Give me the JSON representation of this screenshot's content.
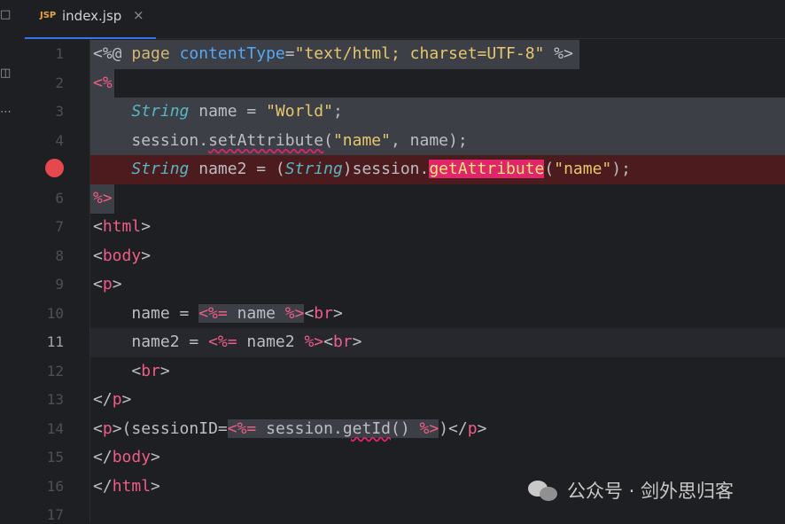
{
  "tab": {
    "badge": "JSP",
    "title": "index.jsp",
    "close": "×"
  },
  "line_numbers": [
    "1",
    "2",
    "3",
    "4",
    "5",
    "6",
    "7",
    "8",
    "9",
    "10",
    "11",
    "12",
    "13",
    "14",
    "15",
    "16",
    "17"
  ],
  "current_line": 11,
  "breakpoint_line": 5,
  "code": {
    "l1": {
      "open": "<%@",
      "page": "page",
      "attr": "contentType",
      "eq": "=",
      "value": "\"text/html; charset=UTF-8\"",
      "close": "%>"
    },
    "l2": {
      "open": "<%"
    },
    "l3": {
      "type": "String",
      "rest": " name = ",
      "value": "\"World\"",
      "semi": ";"
    },
    "l4": {
      "obj": "session",
      "dot": ".",
      "method": "setAttribute",
      "args_open": "(",
      "arg1": "\"name\"",
      "args_rest": ", name",
      "args_close": ");"
    },
    "l5": {
      "type": "String",
      "rest": " name2 = (",
      "cast": "String",
      "obj": ")session",
      "dot": ".",
      "method": "getAttribute",
      "paren": "(",
      "arg": "\"name\"",
      "close": ");"
    },
    "l6": {
      "close": "%>"
    },
    "l7": {
      "lt": "<",
      "tag": "html",
      "gt": ">"
    },
    "l8": {
      "lt": "<",
      "tag": "body",
      "gt": ">"
    },
    "l9": {
      "lt": "<",
      "tag": "p",
      "gt": ">"
    },
    "l10": {
      "text": "name = ",
      "expr_open": "<%=",
      "expr": " name ",
      "expr_close": "%>",
      "lt": "<",
      "tag": "br",
      "gt": ">"
    },
    "l11": {
      "text": "name2 = ",
      "expr_open": "<%=",
      "expr": " name2 ",
      "expr_close": "%>",
      "lt": "<",
      "tag": "br",
      "gt": ">"
    },
    "l12": {
      "lt": "<",
      "tag": "br",
      "gt": ">"
    },
    "l13": {
      "lt": "</",
      "tag": "p",
      "gt": ">"
    },
    "l14": {
      "lt": "<",
      "tag": "p",
      "gt": ">",
      "text": "(sessionID=",
      "expr_open": "<%=",
      "obj": " session",
      "dot": ".",
      "method": "getId",
      "call": "() ",
      "expr_close": "%>",
      "after": ")",
      "lt2": "</",
      "tag2": "p",
      "gt2": ">"
    },
    "l15": {
      "lt": "</",
      "tag": "body",
      "gt": ">"
    },
    "l16": {
      "lt": "</",
      "tag": "html",
      "gt": ">"
    }
  },
  "watermark": {
    "text": "公众号 · 剑外思归客"
  },
  "colors": {
    "background": "#1e1f22",
    "scriptlet_highlight": "#3c3f45",
    "breakpoint": "#e5484d",
    "error_highlight": "#e0256b",
    "tab_underline": "#3574f0"
  }
}
